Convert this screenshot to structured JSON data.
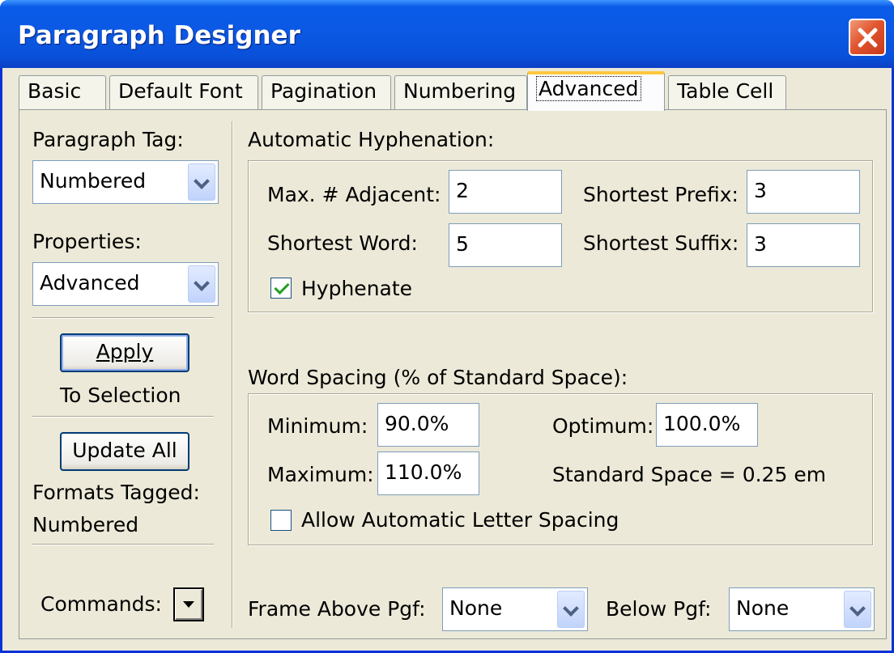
{
  "window": {
    "title": "Paragraph Designer",
    "close_icon": "close-icon",
    "close_color": "#e1552f",
    "title_color": "#0b58e3"
  },
  "tabs": [
    {
      "label": "Basic",
      "active": false
    },
    {
      "label": "Default Font",
      "active": false
    },
    {
      "label": "Pagination",
      "active": false
    },
    {
      "label": "Numbering",
      "active": false
    },
    {
      "label": "Advanced",
      "active": true
    },
    {
      "label": "Table Cell",
      "active": false
    }
  ],
  "sidebar": {
    "paragraph_tag_label": "Paragraph Tag:",
    "paragraph_tag_value": "Numbered",
    "properties_label": "Properties:",
    "properties_value": "Advanced",
    "apply_label": "Apply",
    "apply_sub": "To Selection",
    "update_all_label": "Update All",
    "formats_tagged_label": "Formats Tagged:",
    "formats_tagged_value": "Numbered",
    "commands_label": "Commands:"
  },
  "hyphenation": {
    "heading": "Automatic Hyphenation:",
    "max_adjacent_label": "Max. # Adjacent:",
    "max_adjacent_value": "2",
    "shortest_prefix_label": "Shortest Prefix:",
    "shortest_prefix_value": "3",
    "shortest_word_label": "Shortest Word:",
    "shortest_word_value": "5",
    "shortest_suffix_label": "Shortest Suffix:",
    "shortest_suffix_value": "3",
    "hyphenate_label": "Hyphenate",
    "hyphenate_checked": true
  },
  "word_spacing": {
    "heading": "Word Spacing (% of Standard Space):",
    "minimum_label": "Minimum:",
    "minimum_value": "90.0%",
    "optimum_label": "Optimum:",
    "optimum_value": "100.0%",
    "maximum_label": "Maximum:",
    "maximum_value": "110.0%",
    "standard_space": "Standard Space = 0.25 em",
    "letter_spacing_label": "Allow Automatic Letter Spacing",
    "letter_spacing_checked": false
  },
  "frames": {
    "above_label": "Frame Above Pgf:",
    "above_value": "None",
    "below_label": "Below Pgf:",
    "below_value": "None"
  }
}
